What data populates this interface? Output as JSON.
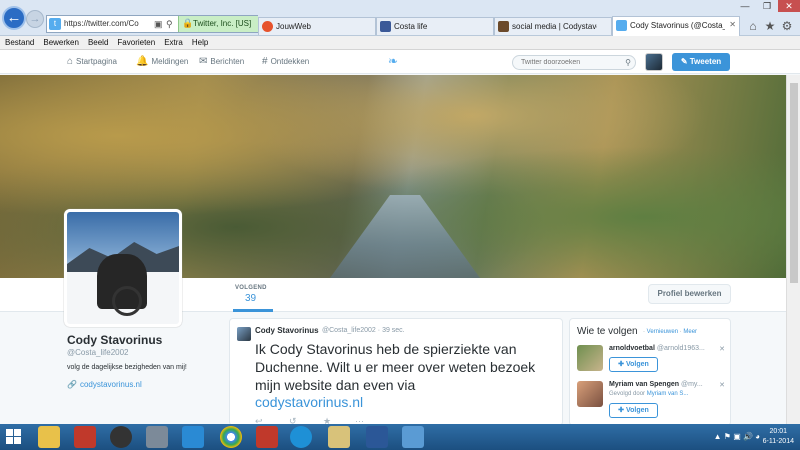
{
  "browser": {
    "url": "https://twitter.com/Co",
    "cert_label": "Twitter, Inc. [US]",
    "tabs": [
      {
        "label": "JouwWeb",
        "icon": "jouwweb-icon"
      },
      {
        "label": "Costa life",
        "icon": "facebook-icon"
      },
      {
        "label": "social media | Codystavorinus...",
        "icon": "page-icon"
      },
      {
        "label": "Cody Stavorinus (@Costa_...",
        "icon": "twitter-icon"
      }
    ],
    "menu": [
      "Bestand",
      "Bewerken",
      "Beeld",
      "Favorieten",
      "Extra",
      "Help"
    ]
  },
  "twitter_nav": {
    "home": "Startpagina",
    "notifications": "Meldingen",
    "messages": "Berichten",
    "discover": "Ontdekken",
    "search_placeholder": "Twitter doorzoeken",
    "tweet_button": "Tweeten"
  },
  "profile": {
    "name": "Cody Stavorinus",
    "handle": "@Costa_life2002",
    "bio": "volg de dagelijkse bezigheden van mij!",
    "website": "codystavorinus.nl",
    "following_label": "VOLGEND",
    "following_count": "39",
    "edit_button": "Profiel bewerken"
  },
  "tweet": {
    "author_name": "Cody Stavorinus",
    "author_handle": "@Costa_life2002",
    "separator": "·",
    "time": "39 sec.",
    "text": "Ik Cody Stavorinus heb de spierziekte van Duchenne. Wilt u er meer over weten bezoek mijn website dan even via",
    "link": "codystavorinus.nl"
  },
  "who_to_follow": {
    "title": "Wie te volgen",
    "refresh": "Vernieuwen",
    "more": "Meer",
    "suggestions": [
      {
        "name": "arnoldvoetbal",
        "handle": "@arnold1963...",
        "followed_by_prefix": "",
        "followed_by": "",
        "follow_label": "Volgen"
      },
      {
        "name": "Myriam van Spengen",
        "handle": "@my...",
        "followed_by_prefix": "Gevolgd door",
        "followed_by": "Myriam van S...",
        "follow_label": "Volgen"
      }
    ]
  },
  "taskbar": {
    "time": "20:01",
    "date": "6-11-2014"
  },
  "colors": {
    "accent": "#3b94d9",
    "twitter_blue": "#55acee",
    "taskbar": "#1c4f80"
  }
}
